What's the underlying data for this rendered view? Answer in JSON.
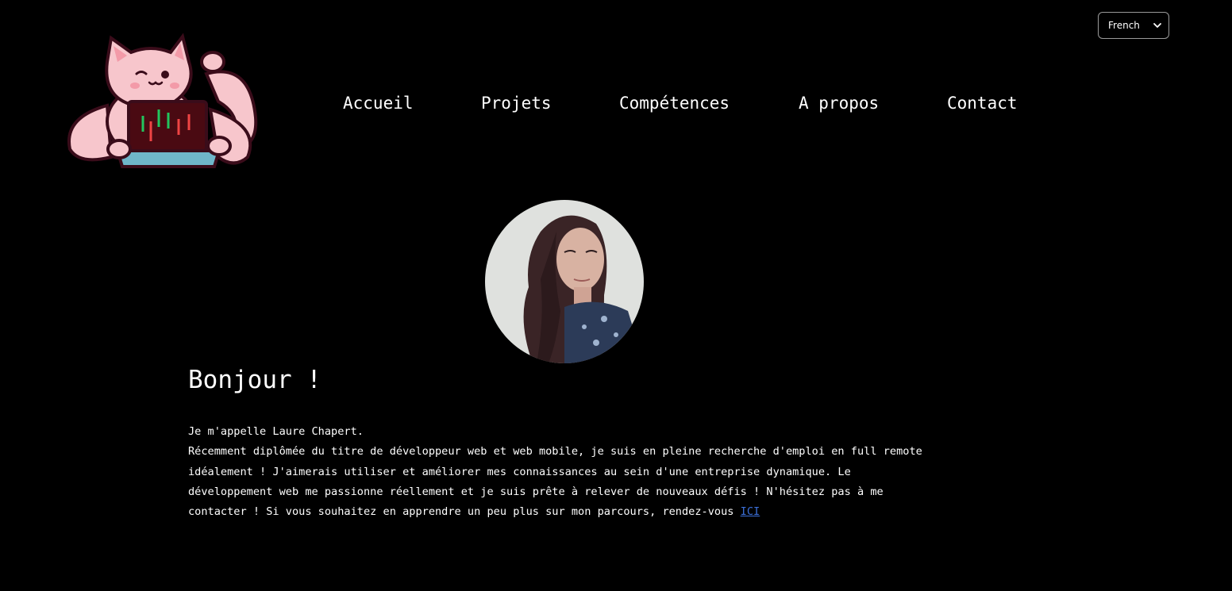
{
  "language_select": {
    "selected": "French"
  },
  "logo": {
    "icon": "fox-mascot-with-laptop-icon"
  },
  "nav": {
    "items": [
      {
        "label": "Accueil"
      },
      {
        "label": "Projets"
      },
      {
        "label": "Compétences"
      },
      {
        "label": "A propos"
      },
      {
        "label": "Contact"
      }
    ]
  },
  "profile": {
    "avatar": "profile-photo"
  },
  "hero": {
    "greeting": "Bonjour !",
    "intro_line1": "Je m'appelle Laure Chapert.",
    "intro_body": "Récemment diplômée du titre de développeur web et web mobile, je suis en pleine recherche d'emploi en full remote idéalement ! J'aimerais utiliser et améliorer mes connaissances au sein d'une entreprise dynamique. Le développement web me passionne réellement et je suis prête à relever de nouveaux défis ! N'hésitez pas à me contacter ! Si vous souhaitez en apprendre un peu plus sur mon parcours, rendez-vous ",
    "link_label": "ICI"
  },
  "colors": {
    "background": "#000000",
    "text": "#ffffff",
    "link": "#3b6fd8",
    "mascot_pink": "#f7c6cc"
  }
}
